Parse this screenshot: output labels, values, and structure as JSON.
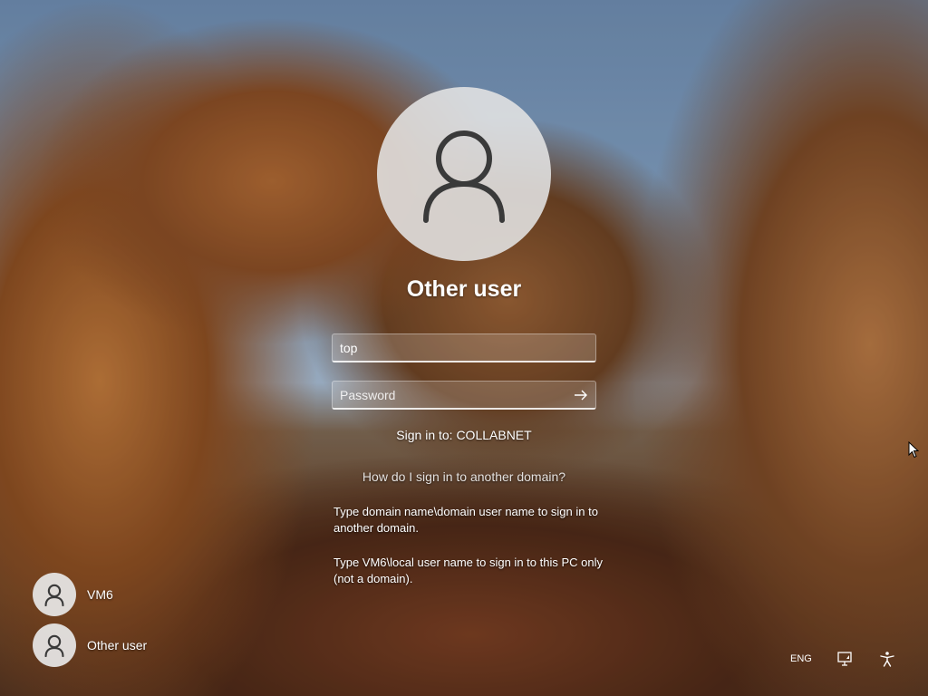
{
  "main": {
    "username": "Other user",
    "username_field": {
      "value": "top"
    },
    "password_field": {
      "placeholder": "Password"
    },
    "sign_in_to": "Sign in to: COLLABNET",
    "how_link": "How do I sign in to another domain?",
    "help_1": "Type domain name\\domain user name to sign in to another domain.",
    "help_2": "Type VM6\\local user name to sign in to this PC only (not a domain)."
  },
  "users": [
    {
      "name": "VM6",
      "icon": "user-avatar-icon"
    },
    {
      "name": "Other user",
      "icon": "user-avatar-icon"
    }
  ],
  "tray": {
    "language": "ENG",
    "network_icon": "network-icon",
    "accessibility_icon": "accessibility-icon"
  },
  "colors": {
    "avatar_bg": "#e4e4e4",
    "icon_stroke": "#3a3a3a"
  }
}
